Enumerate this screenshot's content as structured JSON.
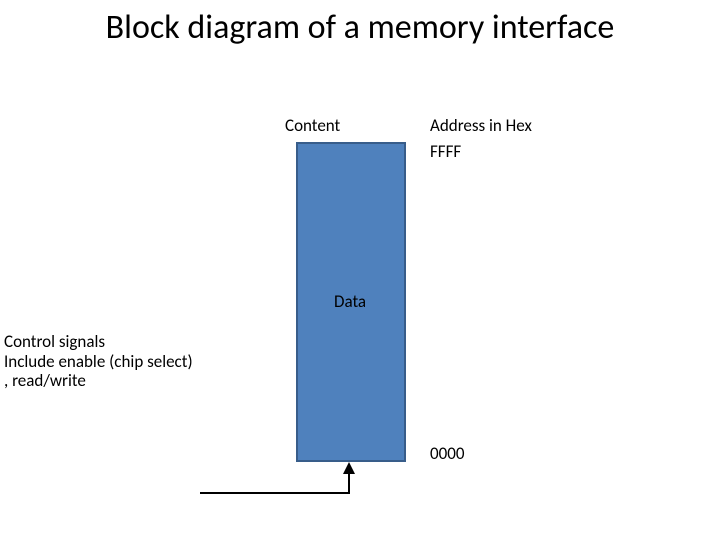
{
  "title": "Block diagram of a memory\ninterface",
  "labels": {
    "content": "Content",
    "address_header": "Address in Hex",
    "addr_high": "FFFF",
    "addr_low": "0000",
    "data": "Data",
    "control": "Control signals\nInclude enable (chip select)\n, read/write"
  }
}
